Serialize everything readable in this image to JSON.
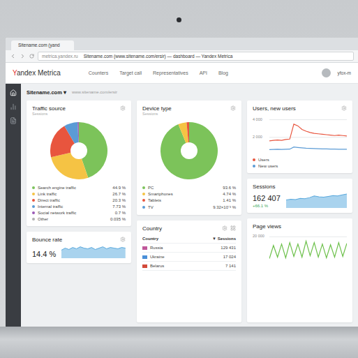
{
  "browser": {
    "tab": "Sitename.com (yand",
    "url": "metrica.yandex.ru",
    "title": "Sitename.com (www.sitename.com/ersir) — dashboard — Yandex Metrica"
  },
  "header": {
    "logo": "Yandex Metrica",
    "nav": [
      {
        "label": "Counters",
        "selected": false
      },
      {
        "label": "Target call",
        "selected": false
      },
      {
        "label": "Representatives",
        "selected": false
      },
      {
        "label": "API",
        "selected": false
      },
      {
        "label": "Blog",
        "selected": false
      }
    ],
    "user": "yfox-m"
  },
  "sidebar": {
    "items": [
      {
        "selected": true
      },
      {
        "selected": false
      },
      {
        "selected": false
      }
    ]
  },
  "site": {
    "name": "Sitename.com",
    "dropdown": "▾",
    "url": "www.sitename.com/ersir"
  },
  "traffic_source": {
    "title": "Traffic source",
    "subtitle": "Sessions",
    "items": [
      {
        "label": "Search engine traffic",
        "value": "44.9 %",
        "share": 44.9,
        "color": "#7cc35a"
      },
      {
        "label": "Link traffic",
        "value": "26.7 %",
        "share": 26.7,
        "color": "#f5c344"
      },
      {
        "label": "Direct traffic",
        "value": "20.3 %",
        "share": 20.3,
        "color": "#e8553e"
      },
      {
        "label": "Internal traffic",
        "value": "7.73 %",
        "share": 7.73,
        "color": "#5b9bd5"
      },
      {
        "label": "Social network traffic",
        "value": "0.7 %",
        "share": 0.7,
        "color": "#9b59b6"
      },
      {
        "label": "Other",
        "value": "0.035 %",
        "share": 0.035,
        "color": "#b0b0b0"
      }
    ]
  },
  "device_type": {
    "title": "Device type",
    "subtitle": "Sessions",
    "items": [
      {
        "label": "PC",
        "value": "93.6 %",
        "share": 93.6,
        "color": "#7cc35a"
      },
      {
        "label": "Smartphones",
        "value": "4.74 %",
        "share": 4.74,
        "color": "#f5c344"
      },
      {
        "label": "Tablets",
        "value": "1.41 %",
        "share": 1.41,
        "color": "#e8553e"
      },
      {
        "label": "TV",
        "value": "9.32×10⁻³ %",
        "share": 0.00932,
        "color": "#5b9bd5"
      }
    ]
  },
  "users": {
    "title": "Users, new users",
    "ticks": [
      {
        "label": "4 000",
        "value": 4000
      },
      {
        "label": "2 000",
        "value": 2000
      }
    ],
    "series": [
      {
        "name": "Users",
        "color": "#e8553e",
        "values": [
          1600,
          1650,
          1700,
          1650,
          1750,
          1800,
          3500,
          3300,
          2900,
          2700,
          2550,
          2450,
          2400,
          2350,
          2300,
          2250,
          2200,
          2250,
          2200,
          2150
        ]
      },
      {
        "name": "New users",
        "color": "#5b9bd5",
        "values": [
          600,
          620,
          640,
          630,
          650,
          660,
          900,
          850,
          800,
          760,
          740,
          720,
          700,
          690,
          680,
          670,
          660,
          650,
          650,
          640
        ]
      }
    ]
  },
  "sessions": {
    "title": "Sessions",
    "value": "162 407",
    "change": "+66.1 %",
    "values": [
      20,
      22,
      21,
      24,
      23,
      26,
      30,
      28,
      27,
      29,
      31,
      30,
      33,
      35
    ]
  },
  "bounce_rate": {
    "title": "Bounce rate",
    "value": "14.4 %",
    "values": [
      12,
      15,
      13,
      16,
      14,
      17,
      15,
      14,
      16,
      13,
      15,
      17,
      14,
      16,
      15,
      14,
      16,
      15
    ]
  },
  "country": {
    "title": "Country",
    "columns": [
      "Country",
      "Sessions"
    ],
    "sort_icon": "▼",
    "rows": [
      {
        "name": "Russia",
        "sessions": "129 431",
        "color": "#c0579a"
      },
      {
        "name": "Ukraine",
        "sessions": "17 024",
        "color": "#4a8fd8"
      },
      {
        "name": "Belarus",
        "sessions": "7 141",
        "color": "#d24a3a"
      }
    ]
  },
  "page_views": {
    "title": "Page views",
    "ticks": [
      {
        "label": "20 000",
        "value": 20000
      }
    ],
    "values": [
      5000,
      14000,
      6000,
      15000,
      5500,
      16000,
      6500,
      15000,
      6000,
      17000,
      7000,
      16000,
      6000,
      15000,
      5500,
      14500,
      6000,
      16000,
      6500,
      15500
    ]
  }
}
